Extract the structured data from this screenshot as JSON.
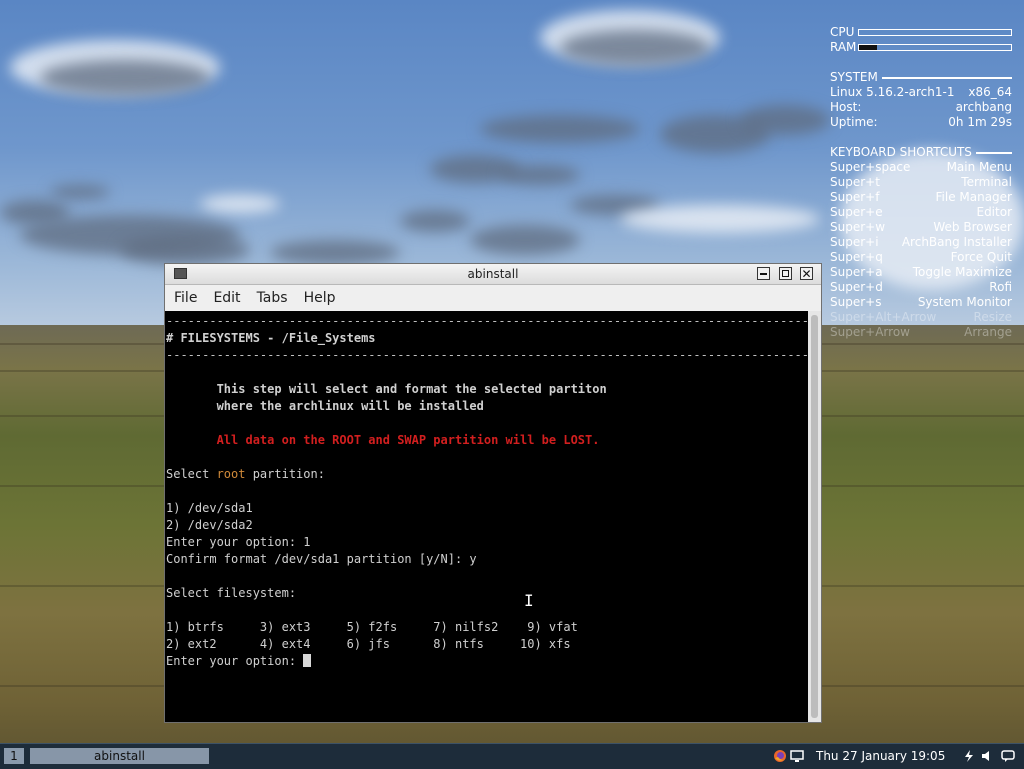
{
  "conky": {
    "cpu_label": "CPU",
    "cpu_level": 0.0,
    "ram_label": "RAM",
    "ram_level": 0.12,
    "system_header": "SYSTEM",
    "kernel": "Linux 5.16.2-arch1-1",
    "arch": "x86_64",
    "host_label": "Host:",
    "host_value": "archbang",
    "uptime_label": "Uptime:",
    "uptime_value": "0h 1m 29s",
    "shortcuts_header": "KEYBOARD SHORTCUTS",
    "shortcuts": [
      {
        "key": "Super+space",
        "action": "Main Menu"
      },
      {
        "key": "Super+t",
        "action": "Terminal"
      },
      {
        "key": "Super+f",
        "action": "File Manager"
      },
      {
        "key": "Super+e",
        "action": "Editor"
      },
      {
        "key": "Super+w",
        "action": "Web Browser"
      },
      {
        "key": "Super+i",
        "action": "ArchBang Installer"
      },
      {
        "key": "Super+q",
        "action": "Force Quit"
      },
      {
        "key": "Super+a",
        "action": "Toggle Maximize"
      },
      {
        "key": "Super+d",
        "action": "Rofi"
      },
      {
        "key": "Super+s",
        "action": "System Monitor"
      },
      {
        "key": "Super+Alt+Arrow",
        "action": "Resize"
      },
      {
        "key": "Super+Arrow",
        "action": "Arrange"
      }
    ]
  },
  "window": {
    "title": "abinstall",
    "icon": "terminal-icon",
    "menu": [
      "File",
      "Edit",
      "Tabs",
      "Help"
    ]
  },
  "terminal": {
    "rule": "-----------------------------------------------------------------------------------------------------",
    "heading": "# FILESYSTEMS - /File_Systems",
    "intro_1": "       This step will select and format the selected partiton",
    "intro_2": "       where the archlinux will be installed",
    "warning": "       All data on the ROOT and SWAP partition will be LOST.",
    "select_root_prefix": "Select ",
    "select_root_word": "root",
    "select_root_suffix": " partition:",
    "option_sda1": "1) /dev/sda1",
    "option_sda2": "2) /dev/sda2",
    "enter_option_1": "Enter your option: 1",
    "confirm": "Confirm format /dev/sda1 partition [y/N]: y",
    "select_fs": "Select filesystem:",
    "fs_row_1": "1) btrfs     3) ext3     5) f2fs     7) nilfs2    9) vfat",
    "fs_row_2": "2) ext2      4) ext4     6) jfs      8) ntfs     10) xfs",
    "prompt": "Enter your option: "
  },
  "taskbar": {
    "workspace": "1",
    "task": "abinstall",
    "clock": "Thu 27 January  19:05",
    "tray_icons": [
      "firefox-icon",
      "display-icon",
      "power-icon",
      "volume-icon",
      "message-icon"
    ]
  },
  "colors": {
    "terminal_bg": "#000000",
    "warning": "#d21f1f",
    "highlight": "#d08a3a",
    "taskbar_bg": "#1d2c3a"
  }
}
